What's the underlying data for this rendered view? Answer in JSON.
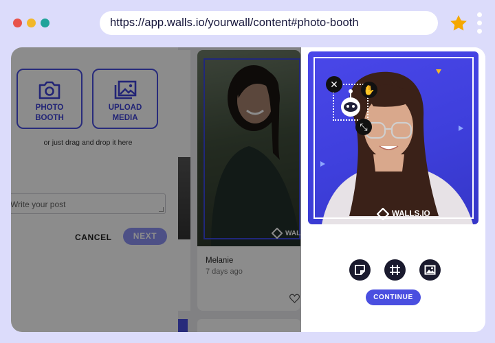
{
  "browser": {
    "url": "https://app.walls.io/yourwall/content#photo-booth",
    "colors": {
      "red": "#e8534a",
      "yellow": "#f2b72a",
      "teal": "#1fa39a",
      "star": "#f5a800"
    }
  },
  "composer": {
    "photo_booth_label": "PHOTO\nBOOTH",
    "upload_media_label": "UPLOAD\nMEDIA",
    "drag_text": "or just drag and drop it here",
    "post_placeholder": "Write your post",
    "cancel_label": "CANCEL",
    "next_label": "NEXT"
  },
  "feed_card": {
    "logo_text": "WAL",
    "author": "Melanie",
    "time_ago": "7 days ago"
  },
  "booth": {
    "brand_text": "WALLS.IO",
    "continue_label": "CONTINUE",
    "accent": "#4a4fe0",
    "icons": [
      "sticker-icon",
      "frame-icon",
      "image-icon"
    ]
  }
}
